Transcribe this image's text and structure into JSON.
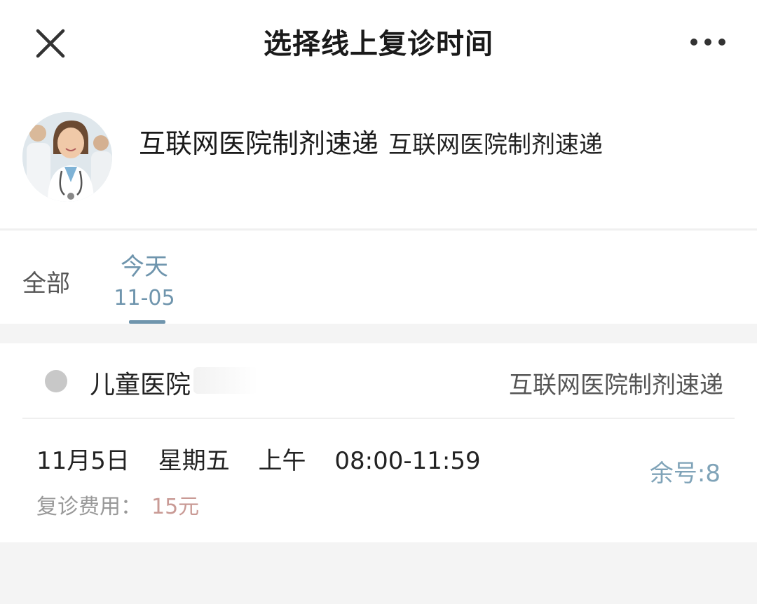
{
  "header": {
    "title": "选择线上复诊时间",
    "close_icon": "close-icon",
    "more_icon": "more-icon"
  },
  "doctor": {
    "name": "互联网医院制剂速递",
    "department": "互联网医院制剂速递"
  },
  "tabs": [
    {
      "label": "全部"
    },
    {
      "label": "今天",
      "date": "11-05",
      "active": true
    }
  ],
  "schedule": {
    "hospital": "儿童医院",
    "department": "互联网医院制剂速递",
    "slots": [
      {
        "date": "11月5日",
        "weekday": "星期五",
        "period": "上午",
        "time_range": "08:00-11:59",
        "fee_label": "复诊费用：",
        "fee_value": "15元",
        "remaining": "余号:8"
      }
    ]
  },
  "colors": {
    "accent": "#6f95ad",
    "fee": "#c99a95",
    "remaining": "#7fa3b8"
  }
}
